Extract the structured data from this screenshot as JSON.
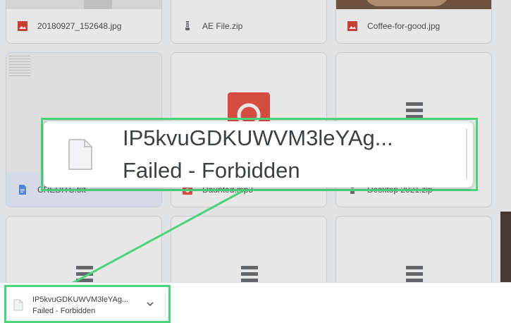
{
  "files": [
    {
      "name": "20180927_152648.jpg",
      "type": "image"
    },
    {
      "name": "AE File.zip",
      "type": "zip"
    },
    {
      "name": "Coffee-for-good.jpg",
      "type": "image"
    },
    {
      "name": "CREDITS.txt",
      "type": "doc"
    },
    {
      "name": "Daunted.mp3",
      "type": "audio"
    },
    {
      "name": "Desktop 2021.zip",
      "type": "zip"
    }
  ],
  "zoom": {
    "filename": "IP5kvuGDKUWVM3leYAg...",
    "status": "Failed - Forbidden"
  },
  "download": {
    "filename": "IP5kvuGDKUWVM3leYAg...",
    "status": "Failed - Forbidden"
  },
  "colors": {
    "highlight": "#4cd47a",
    "image_icon": "#d93025",
    "doc_icon": "#4285f4",
    "audio_icon": "#ea4335"
  }
}
